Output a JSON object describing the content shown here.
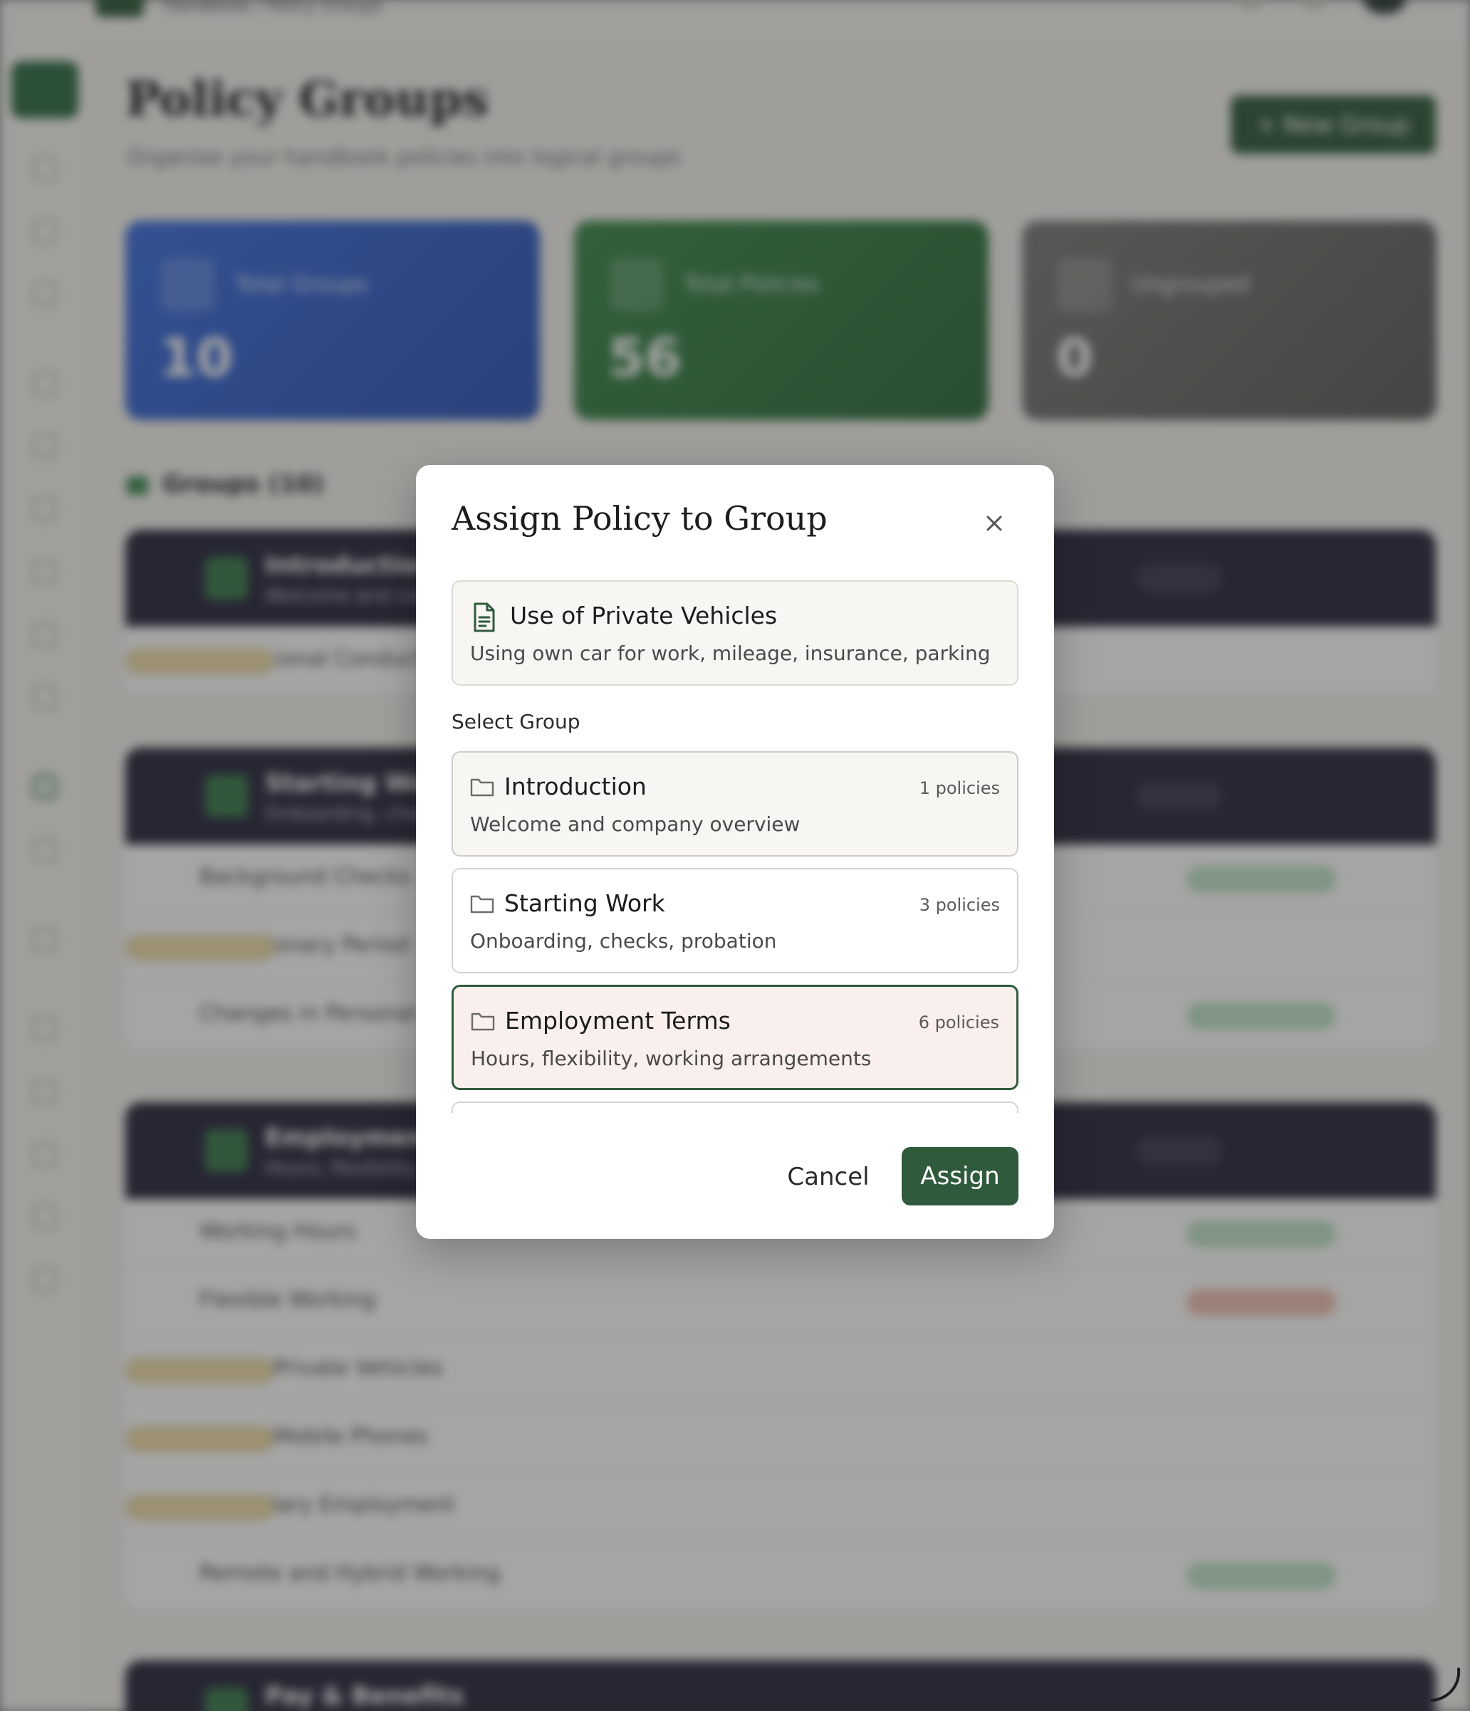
{
  "background": {
    "breadcrumb": "Handbook / Policy Groups",
    "page_title": "Policy Groups",
    "page_subtitle": "Organise your handbook policies into logical groups",
    "new_group_label": "+ New Group",
    "stats": [
      {
        "label": "Total Groups",
        "value": "10"
      },
      {
        "label": "Total Policies",
        "value": "56"
      },
      {
        "label": "Ungrouped",
        "value": "0"
      }
    ],
    "groups_heading": "Groups (10)",
    "groups": [
      {
        "title": "Introduction",
        "subtitle": "Welcome and company overview",
        "rows": [
          "Professional Conduct"
        ]
      },
      {
        "title": "Starting Work",
        "subtitle": "Onboarding, checks, probation",
        "rows": [
          "Background Checks",
          "Probationary Period",
          "Changes in Personal Circumstances"
        ]
      },
      {
        "title": "Employment Terms",
        "subtitle": "Hours, flexibility, working arrangements",
        "rows": [
          "Working Hours",
          "Flexible Working",
          "Use of Private Vehicles",
          "Use of Mobile Phones",
          "Secondary Employment",
          "Remote and Hybrid Working"
        ]
      },
      {
        "title": "Pay & Benefits",
        "subtitle": "",
        "rows": []
      }
    ]
  },
  "modal": {
    "title": "Assign Policy to Group",
    "policy": {
      "title": "Use of Private Vehicles",
      "description": "Using own car for work, mileage, insurance, parking"
    },
    "select_label": "Select Group",
    "options": [
      {
        "title": "Introduction",
        "count": "1 policies",
        "description": "Welcome and company overview",
        "state": "hover"
      },
      {
        "title": "Starting Work",
        "count": "3 policies",
        "description": "Onboarding, checks, probation",
        "state": "normal"
      },
      {
        "title": "Employment Terms",
        "count": "6 policies",
        "description": "Hours, flexibility, working arrangements",
        "state": "selected"
      }
    ],
    "cancel_label": "Cancel",
    "assign_label": "Assign"
  },
  "colors": {
    "accent": "#2f5a3c",
    "selected_bg": "#f9efec",
    "group_header": "#27263f"
  },
  "icons": [
    "close-icon",
    "document-icon",
    "folder-icon"
  ]
}
